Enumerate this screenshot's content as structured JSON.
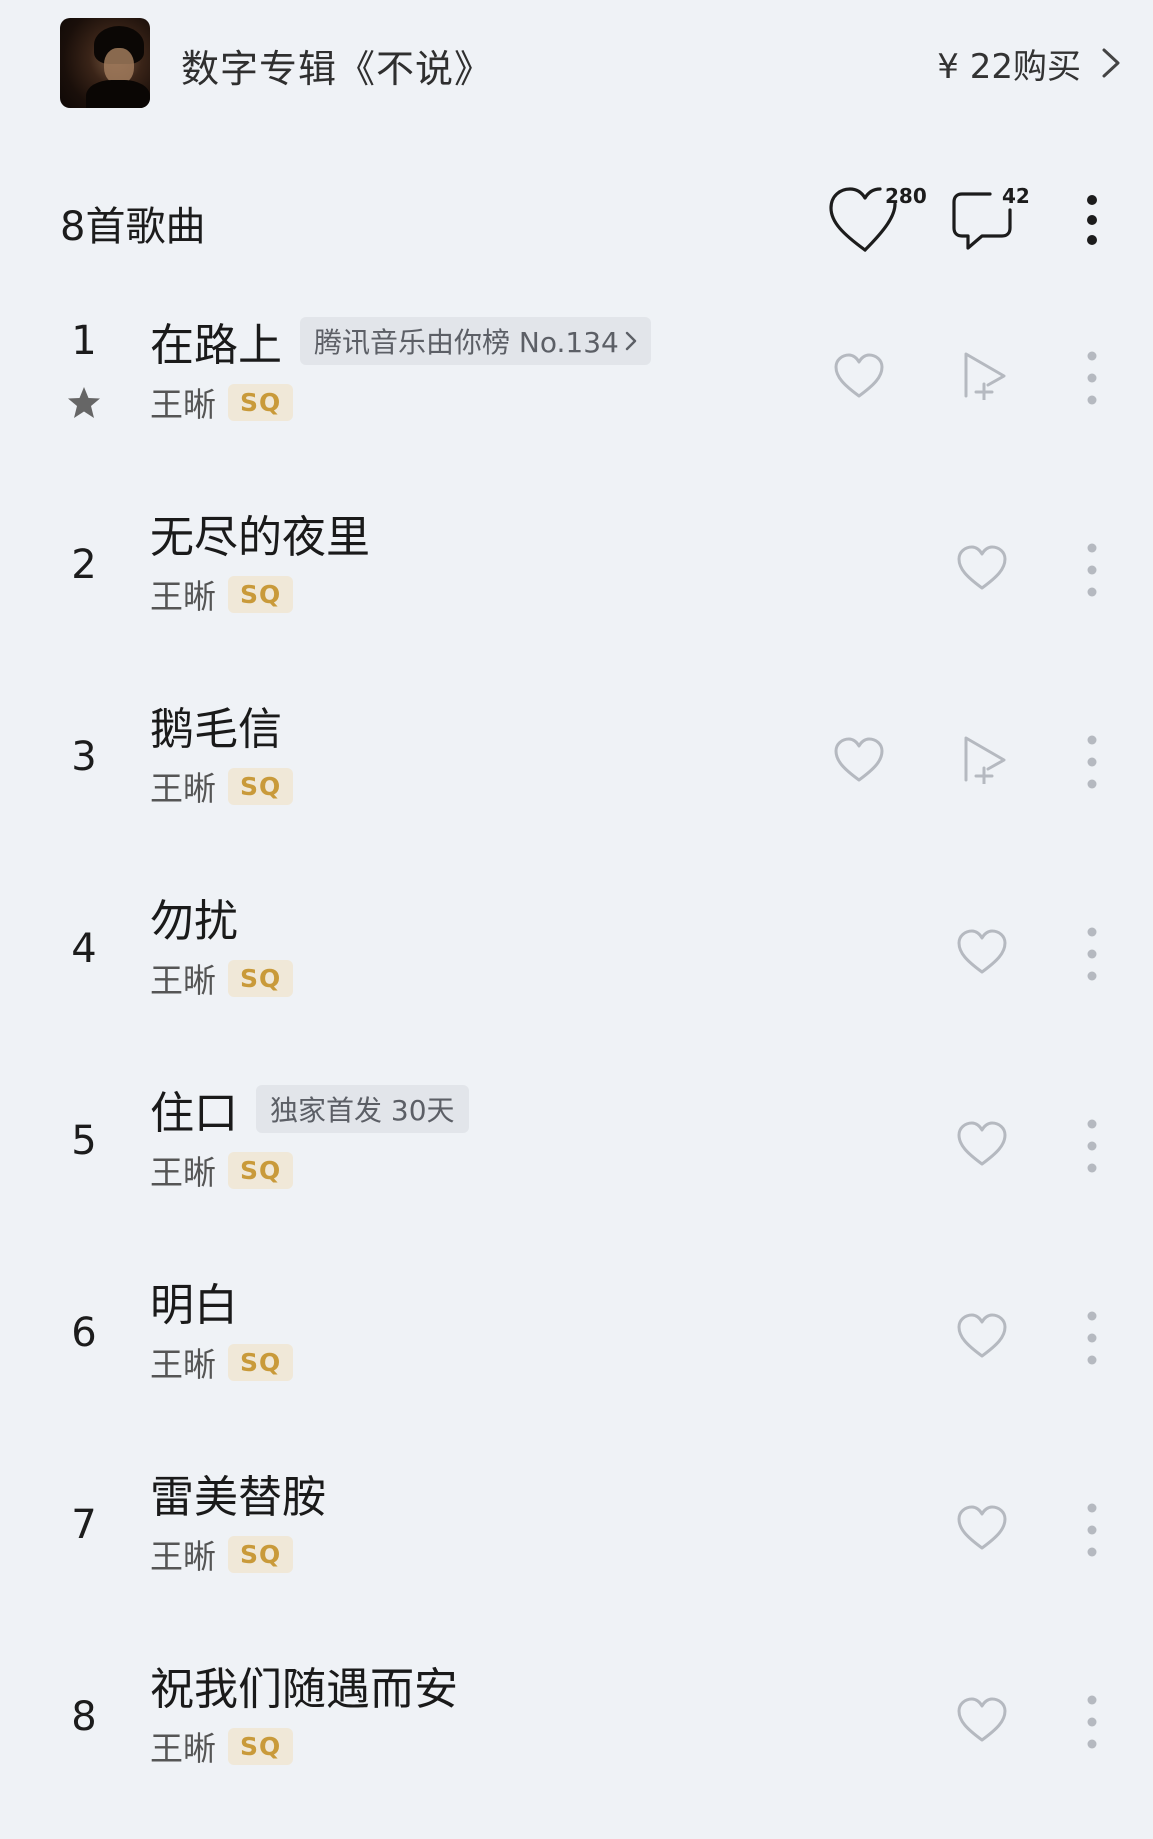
{
  "album": {
    "title": "数字专辑《不说》",
    "price_label": "¥ 22购买"
  },
  "list": {
    "count_label": "8首歌曲",
    "favorites_count": "280",
    "comments_count": "42"
  },
  "songs": [
    {
      "number": "1",
      "title": "在路上",
      "tag": "腾讯音乐由你榜 No.134",
      "artist": "王晰",
      "quality": "SQ",
      "starred": true,
      "has_add_to_playlist": true
    },
    {
      "number": "2",
      "title": "无尽的夜里",
      "tag": "",
      "artist": "王晰",
      "quality": "SQ",
      "starred": false,
      "has_add_to_playlist": false
    },
    {
      "number": "3",
      "title": "鹅毛信",
      "tag": "",
      "artist": "王晰",
      "quality": "SQ",
      "starred": false,
      "has_add_to_playlist": true
    },
    {
      "number": "4",
      "title": "勿扰",
      "tag": "",
      "artist": "王晰",
      "quality": "SQ",
      "starred": false,
      "has_add_to_playlist": false
    },
    {
      "number": "5",
      "title": "住口",
      "tag": "独家首发 30天",
      "artist": "王晰",
      "quality": "SQ",
      "starred": false,
      "has_add_to_playlist": false
    },
    {
      "number": "6",
      "title": "明白",
      "tag": "",
      "artist": "王晰",
      "quality": "SQ",
      "starred": false,
      "has_add_to_playlist": false
    },
    {
      "number": "7",
      "title": "雷美替胺",
      "tag": "",
      "artist": "王晰",
      "quality": "SQ",
      "starred": false,
      "has_add_to_playlist": false
    },
    {
      "number": "8",
      "title": "祝我们随遇而安",
      "tag": "",
      "artist": "王晰",
      "quality": "SQ",
      "starred": false,
      "has_add_to_playlist": false
    }
  ],
  "colors": {
    "background": "#eff2f6",
    "sq_badge_bg": "#f0e8d8",
    "sq_badge_text": "#c99a3a",
    "tag_bg": "#e2e5ea",
    "icon_gray": "#b5b9c0"
  }
}
